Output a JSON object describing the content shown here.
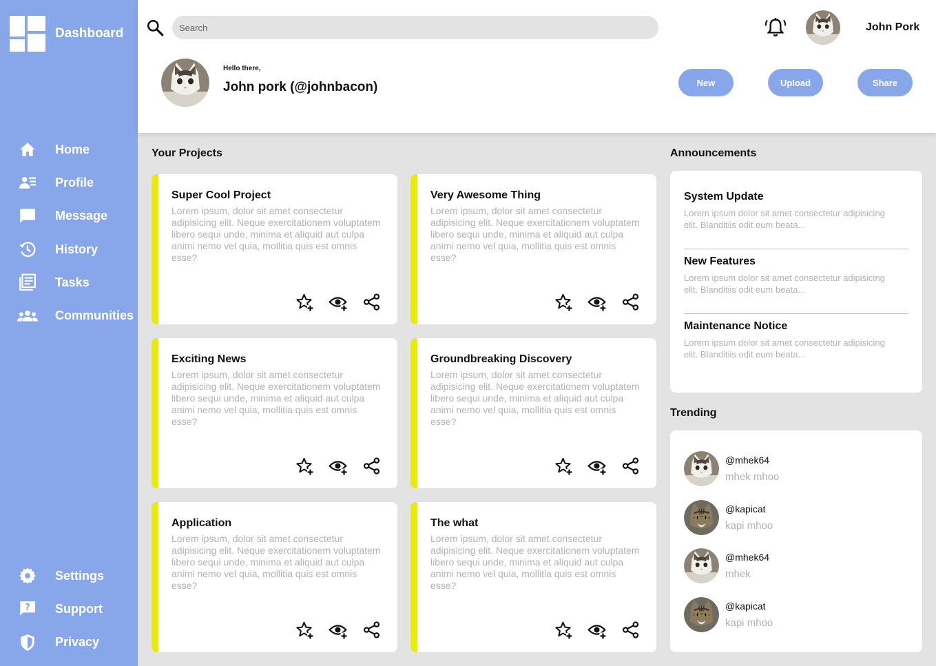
{
  "brand": {
    "title": "Dashboard",
    "icon": "dashboard-grid-icon"
  },
  "sidebar": {
    "top_items": [
      {
        "label": "Home",
        "icon": "home-icon"
      },
      {
        "label": "Profile",
        "icon": "profile-icon"
      },
      {
        "label": "Message",
        "icon": "message-icon"
      },
      {
        "label": "History",
        "icon": "history-icon"
      },
      {
        "label": "Tasks",
        "icon": "tasks-icon"
      },
      {
        "label": "Communities",
        "icon": "communities-icon"
      }
    ],
    "bottom_items": [
      {
        "label": "Settings",
        "icon": "gear-icon"
      },
      {
        "label": "Support",
        "icon": "help-icon"
      },
      {
        "label": "Privacy",
        "icon": "shield-icon"
      }
    ]
  },
  "header": {
    "search_placeholder": "Search",
    "user_name": "John Pork",
    "greeting": "Hello there,",
    "full_name": "John pork (@johnbacon)",
    "buttons": {
      "new": "New",
      "upload": "Upload",
      "share": "Share"
    }
  },
  "projects": {
    "title": "Your Projects",
    "items": [
      {
        "title": "Super Cool Project",
        "body": "Lorem ipsum, dolor sit amet consectetur adipisicing elit. Neque exercitationem voluptatem libero sequi unde, minima et aliquid aut culpa animi nemo vel quia, mollitia quis est omnis esse?"
      },
      {
        "title": "Very Awesome Thing",
        "body": "Lorem ipsum, dolor sit amet consectetur adipisicing elit. Neque exercitationem voluptatem libero sequi unde, minima et aliquid aut culpa animi nemo vel quia, mollitia quis est omnis esse?"
      },
      {
        "title": "Exciting News",
        "body": "Lorem ipsum, dolor sit amet consectetur adipisicing elit. Neque exercitationem voluptatem libero sequi unde, minima et aliquid aut culpa animi nemo vel quia, mollitia quis est omnis esse?"
      },
      {
        "title": "Groundbreaking Discovery",
        "body": "Lorem ipsum, dolor sit amet consectetur adipisicing elit. Neque exercitationem voluptatem libero sequi unde, minima et aliquid aut culpa animi nemo vel quia, mollitia quis est omnis esse?"
      },
      {
        "title": "Application",
        "body": "Lorem ipsum, dolor sit amet consectetur adipisicing elit. Neque exercitationem voluptatem libero sequi unde, minima et aliquid aut culpa animi nemo vel quia, mollitia quis est omnis esse?"
      },
      {
        "title": "The what",
        "body": "Lorem ipsum, dolor sit amet consectetur adipisicing elit. Neque exercitationem voluptatem libero sequi unde, minima et aliquid aut culpa animi nemo vel quia, mollitia quis est omnis esse?"
      }
    ],
    "action_icons": [
      "star-plus-icon",
      "eye-plus-icon",
      "share-icon"
    ],
    "accent_color": "#e8ea0b"
  },
  "announcements": {
    "title": "Announcements",
    "items": [
      {
        "title": "System Update",
        "body": "Lorem ipsum dolor sit amet consectetur adipisicing elit. Blanditiis odit eum beata..."
      },
      {
        "title": "New Features",
        "body": "Lorem ipsum dolor sit amet consectetur adipisicing elit. Blanditiis odit eum beata..."
      },
      {
        "title": "Maintenance Notice",
        "body": "Lorem ipsum dolor sit amet consectetur adipisicing elit. Blanditiis odit eum beata..."
      }
    ]
  },
  "trending": {
    "title": "Trending",
    "items": [
      {
        "handle": "@mhek64",
        "name": "mhek mhoo",
        "avatar": "white-cat"
      },
      {
        "handle": "@kapicat",
        "name": "kapi mhoo",
        "avatar": "tabby-cat"
      },
      {
        "handle": "@mhek64",
        "name": "mhek",
        "avatar": "white-cat"
      },
      {
        "handle": "@kapicat",
        "name": "kapi mhoo",
        "avatar": "tabby-cat"
      }
    ]
  },
  "colors": {
    "sidebar": "#88a7ea",
    "background": "#e3e3e3",
    "card": "#ffffff",
    "muted_text": "#b2b2b2"
  }
}
